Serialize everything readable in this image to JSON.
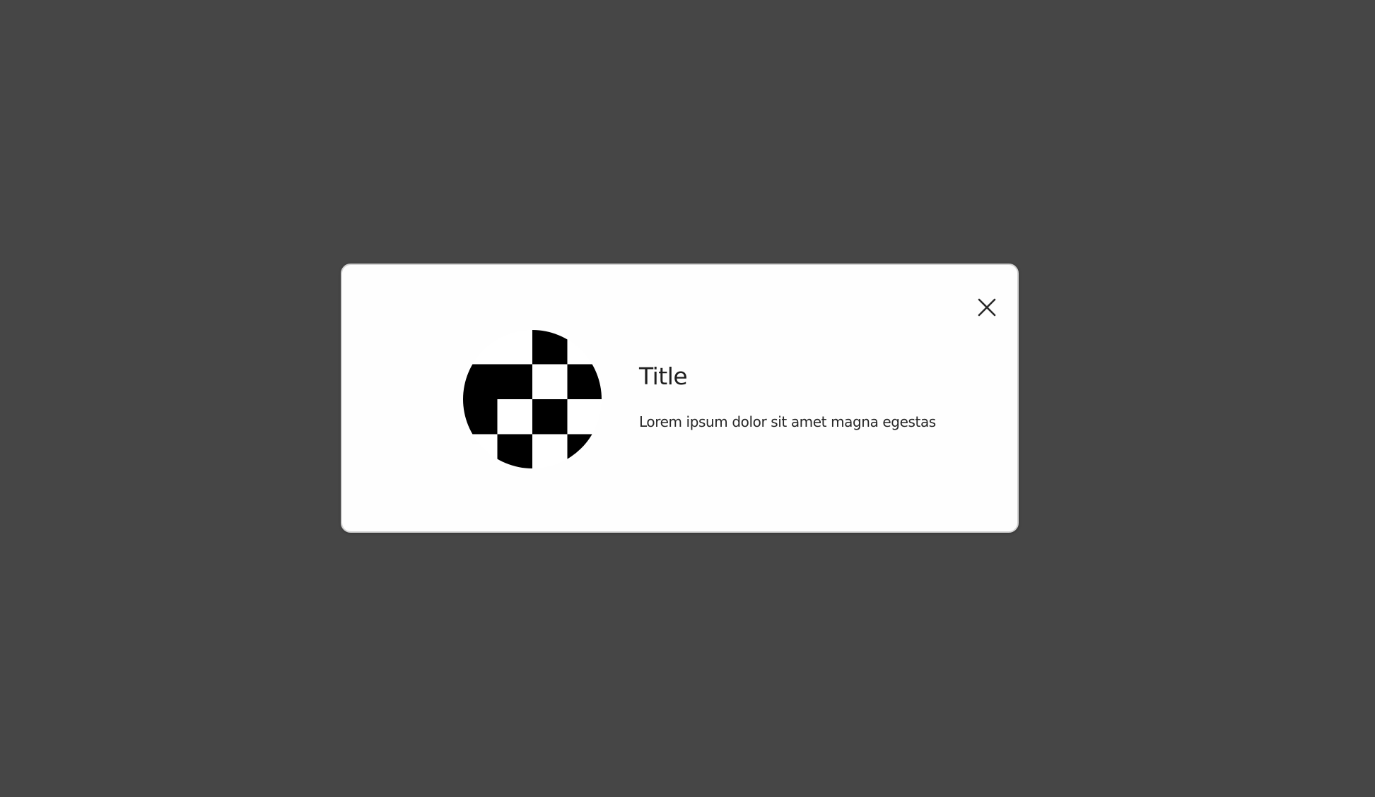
{
  "modal": {
    "title": "Title",
    "body": "Lorem ipsum dolor sit amet magna egestas",
    "close_icon": "close-icon",
    "illustration_icon": "checkerboard-circle-icon"
  },
  "colors": {
    "backdrop": "#464646",
    "modal_background": "#fefefe",
    "modal_border": "#d2d2d2",
    "text": "#1f1f1f",
    "checker_dark": "#000000",
    "checker_light": "#ffffff"
  }
}
